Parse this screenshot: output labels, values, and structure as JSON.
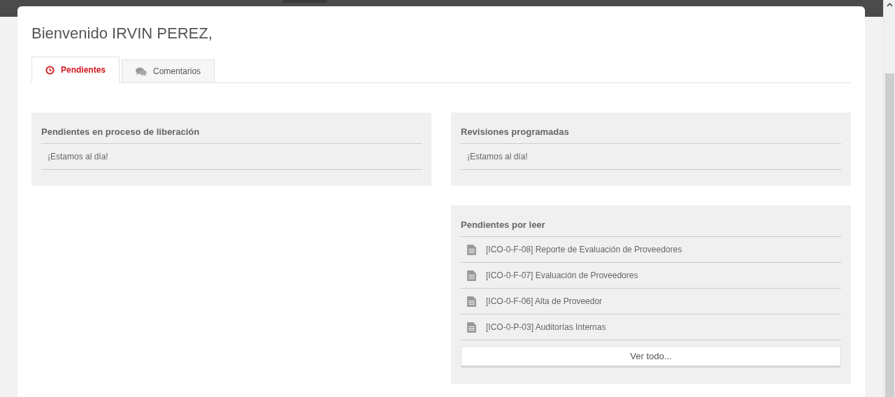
{
  "greeting": "Bienvenido IRVIN PEREZ,",
  "tabs": [
    {
      "label": "Pendientes",
      "kind": "clock",
      "selected": true
    },
    {
      "label": "Comentarios",
      "kind": "comments",
      "selected": false
    }
  ],
  "panels_left": [
    {
      "title": "Pendientes en proceso de liberación",
      "items": [
        {
          "kind": "message",
          "text": "¡Estamos al día!"
        }
      ]
    }
  ],
  "panels_right": [
    {
      "title": "Revisiones programadas",
      "items": [
        {
          "kind": "message",
          "text": "¡Estamos al día!"
        }
      ]
    },
    {
      "title": "Pendientes por leer",
      "items": [
        {
          "kind": "document",
          "text": "[ICO-0-F-08] Reporte de Evaluación de Proveedores"
        },
        {
          "kind": "document",
          "text": "[ICO-0-F-07] Evaluación de Proveedores"
        },
        {
          "kind": "document",
          "text": "[ICO-0-F-06] Alta de Proveedor"
        },
        {
          "kind": "document",
          "text": "[ICO-0-P-03] Auditorías Internas"
        }
      ],
      "button": "Ver todo..."
    }
  ]
}
